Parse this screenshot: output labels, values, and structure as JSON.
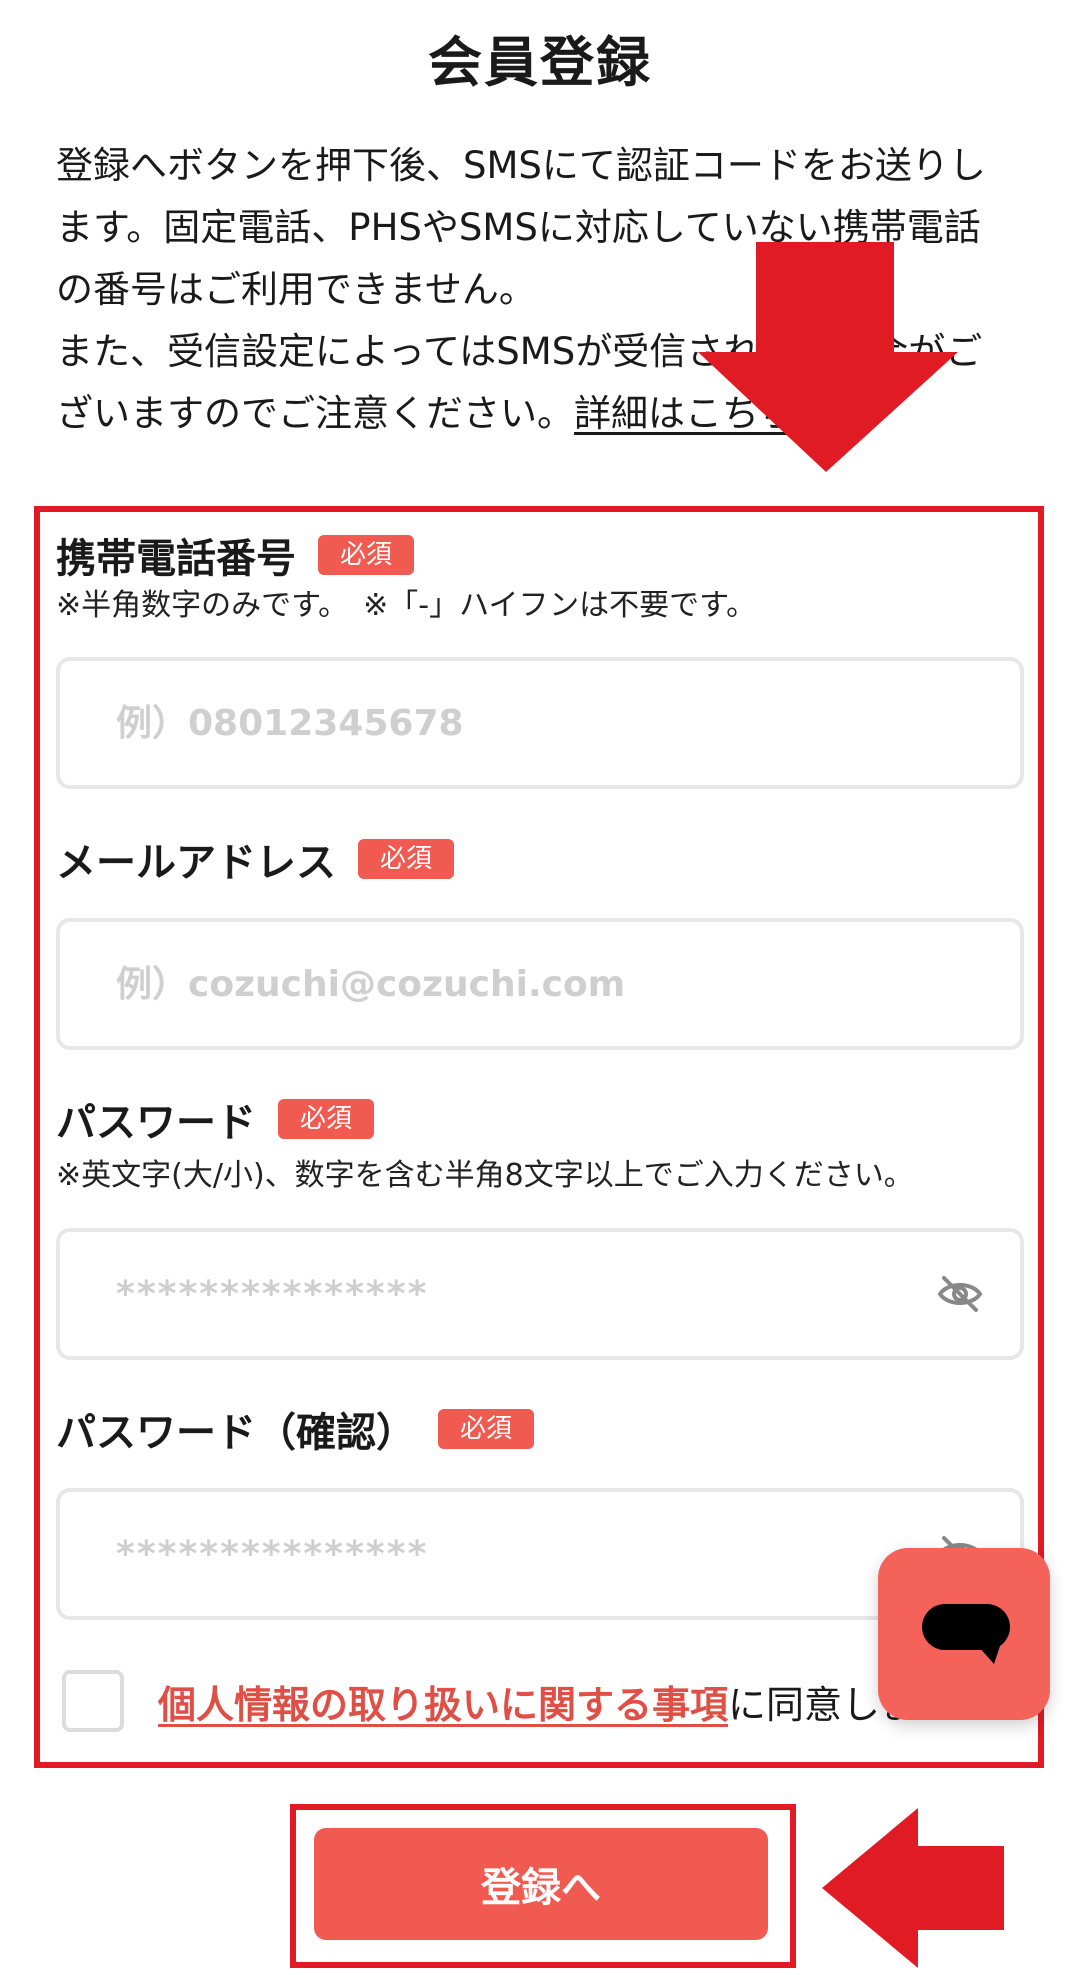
{
  "page": {
    "title": "会員登録"
  },
  "intro": {
    "line1": "登録へボタンを押下後、SMSにて認証コードをお送りします。固定電話、PHSやSMSに対応していない携帯電話の番号はご利用できません。",
    "line2": "また、受信設定によってはSMSが受信されない場合がございますのでご注意ください。",
    "details_link": "詳細はこちら"
  },
  "form": {
    "required_badge": "必須",
    "phone": {
      "label": "携帯電話番号",
      "note": "※半角数字のみです。　※「-」ハイフンは不要です。",
      "placeholder": "例）08012345678"
    },
    "email": {
      "label": "メールアドレス",
      "placeholder": "例）cozuchi@cozuchi.com"
    },
    "password": {
      "label": "パスワード",
      "note": "※英文字(大/小)、数字を含む半角8文字以上でご入力ください。",
      "placeholder": "***************",
      "toggle_icon": "eye-off-icon"
    },
    "password_confirm": {
      "label": "パスワード（確認）",
      "placeholder": "***************",
      "toggle_icon": "eye-off-icon"
    },
    "consent": {
      "link_text": "個人情報の取り扱いに関する事項",
      "suffix": "に同意します"
    }
  },
  "submit": {
    "label": "登録へ"
  },
  "chat": {
    "icon": "chat-bubble-icon"
  },
  "colors": {
    "accent": "#f15a50",
    "annotation_red": "#e01b24",
    "link_red": "#e04f45",
    "input_border": "#e7e7e7",
    "placeholder": "#cfcfcf"
  }
}
